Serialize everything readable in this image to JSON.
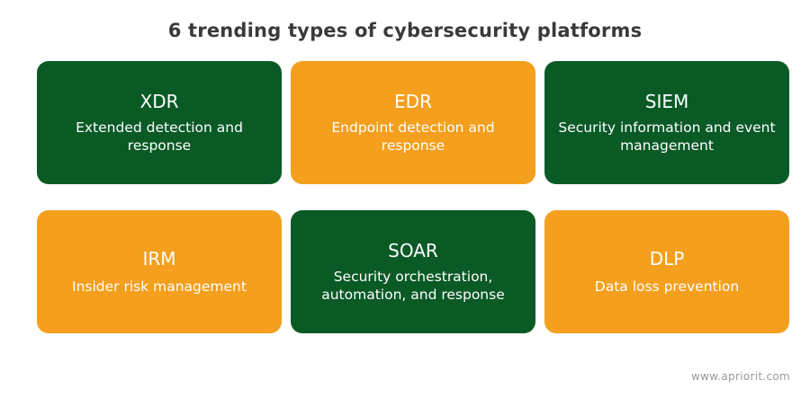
{
  "title": "6 trending types of cybersecurity platforms",
  "colors": {
    "green": "#0a5a26",
    "orange": "#f49f1d",
    "title_text": "#3a3a3a",
    "footer_text": "#9a9a9a"
  },
  "cards": [
    {
      "abbr": "XDR",
      "description": "Extended detection and response",
      "color": "green"
    },
    {
      "abbr": "EDR",
      "description": "Endpoint detection and response",
      "color": "orange"
    },
    {
      "abbr": "SIEM",
      "description": "Security information and event management",
      "color": "green"
    },
    {
      "abbr": "IRM",
      "description": "Insider risk management",
      "color": "orange"
    },
    {
      "abbr": "SOAR",
      "description": "Security orchestration, automation, and response",
      "color": "green"
    },
    {
      "abbr": "DLP",
      "description": "Data loss prevention",
      "color": "orange"
    }
  ],
  "footer": "www.apriorit.com"
}
